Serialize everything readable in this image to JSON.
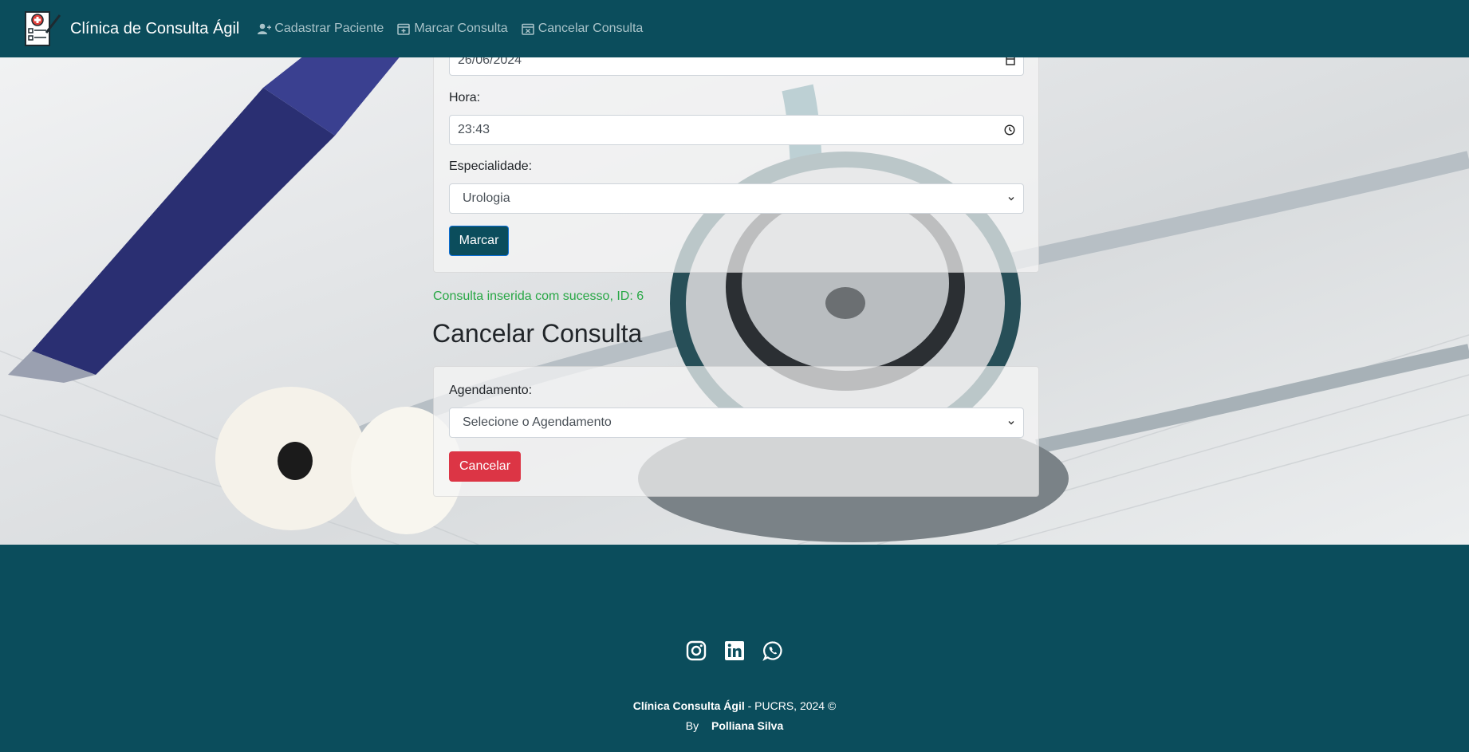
{
  "app": {
    "brand": "Clínica de Consulta Ágil"
  },
  "nav": {
    "items": [
      {
        "label": "Cadastrar Paciente",
        "icon": "user-plus-icon"
      },
      {
        "label": "Marcar Consulta",
        "icon": "calendar-plus-icon"
      },
      {
        "label": "Cancelar Consulta",
        "icon": "calendar-x-icon"
      }
    ]
  },
  "marcar_form": {
    "date_value": "26/06/2024",
    "hora_label": "Hora:",
    "hora_value": "23:43",
    "especialidade_label": "Especialidade:",
    "especialidade_value": "Urologia",
    "submit_label": "Marcar"
  },
  "success_message": "Consulta inserida com sucesso, ID: 6",
  "cancelar_section": {
    "title": "Cancelar Consulta",
    "agendamento_label": "Agendamento:",
    "agendamento_value": "Selecione o Agendamento",
    "submit_label": "Cancelar"
  },
  "footer": {
    "socials": [
      "instagram-icon",
      "linkedin-icon",
      "whatsapp-icon"
    ],
    "brand": "Clínica Consulta Ágil",
    "copyright_rest": " - PUCRS, 2024 ©",
    "by": "By",
    "author": "Polliana Silva"
  },
  "colors": {
    "primary": "#0b4d5c",
    "nav_link": "#a9c3c9",
    "success": "#28a745",
    "danger": "#dc3545"
  }
}
